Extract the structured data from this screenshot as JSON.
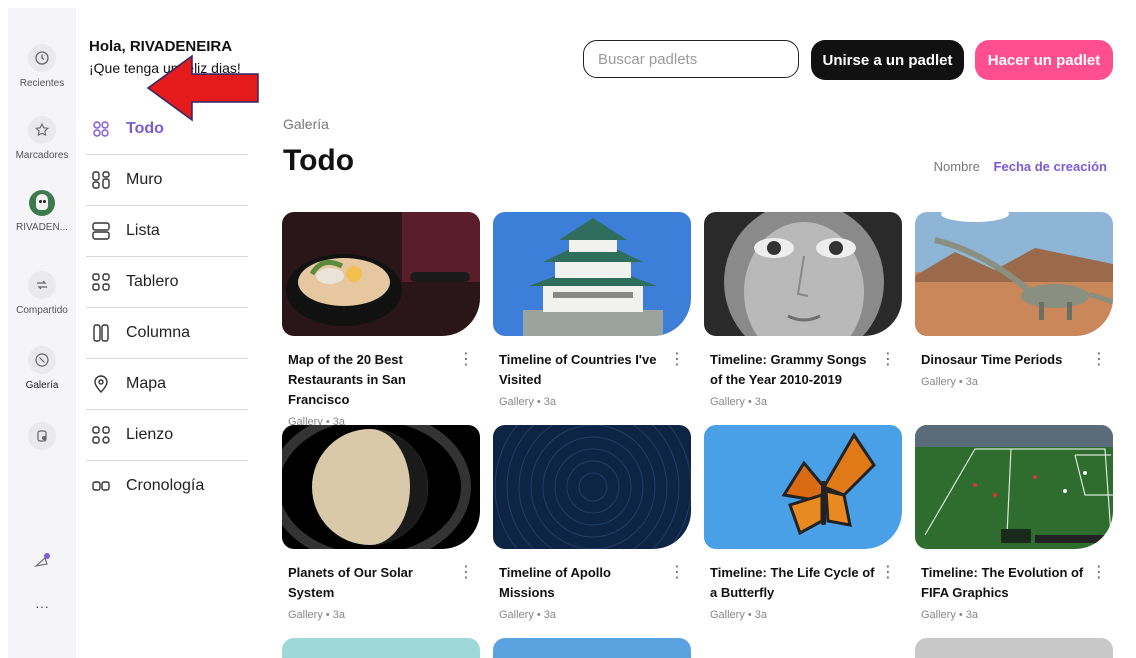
{
  "rail": {
    "items": [
      {
        "label": "Recientes",
        "icon": "clock-icon"
      },
      {
        "label": "Marcadores",
        "icon": "star-icon"
      },
      {
        "label": "RIVADEN...",
        "icon": "avatar"
      },
      {
        "label": "Compartido",
        "icon": "share-icon"
      },
      {
        "label": "Galería",
        "icon": "gallery-icon"
      },
      {
        "label": "",
        "icon": "trash-icon"
      }
    ],
    "more": "···"
  },
  "greeting": {
    "name": "Hola, RIVADENEIRA",
    "subtitle": "¡Que tenga un feliz dias!"
  },
  "header": {
    "search_placeholder": "Buscar padlets",
    "join_label": "Unirse a un padlet",
    "make_label": "Hacer un padlet"
  },
  "nav": {
    "items": [
      {
        "label": "Todo",
        "icon": "all-icon",
        "active": true
      },
      {
        "label": "Muro",
        "icon": "wall-icon"
      },
      {
        "label": "Lista",
        "icon": "list-icon"
      },
      {
        "label": "Tablero",
        "icon": "grid-icon"
      },
      {
        "label": "Columna",
        "icon": "column-icon"
      },
      {
        "label": "Mapa",
        "icon": "map-pin-icon"
      },
      {
        "label": "Lienzo",
        "icon": "canvas-icon"
      },
      {
        "label": "Cronología",
        "icon": "timeline-icon"
      }
    ]
  },
  "main": {
    "breadcrumb": "Galería",
    "title": "Todo",
    "sort": {
      "name": "Nombre",
      "date": "Fecha de creación"
    }
  },
  "cards": [
    {
      "title": "Map of the 20 Best Restaurants in San Francisco",
      "meta": "Gallery • 3a"
    },
    {
      "title": "Timeline of Countries I've Visited",
      "meta": "Gallery • 3a"
    },
    {
      "title": "Timeline: Grammy Songs of the Year 2010-2019",
      "meta": "Gallery • 3a"
    },
    {
      "title": "Dinosaur Time Periods",
      "meta": "Gallery • 3a"
    },
    {
      "title": "Planets of Our Solar System",
      "meta": "Gallery • 3a"
    },
    {
      "title": "Timeline of Apollo Missions",
      "meta": "Gallery • 3a"
    },
    {
      "title": "Timeline: The Life Cycle of a Butterfly",
      "meta": "Gallery • 3a"
    },
    {
      "title": "Timeline: The Evolution of FIFA Graphics",
      "meta": "Gallery • 3a"
    }
  ],
  "colors": {
    "accent": "#7c5ad8",
    "brand_pink": "#ff4f8e",
    "annotation_arrow": "#e51b1b"
  }
}
